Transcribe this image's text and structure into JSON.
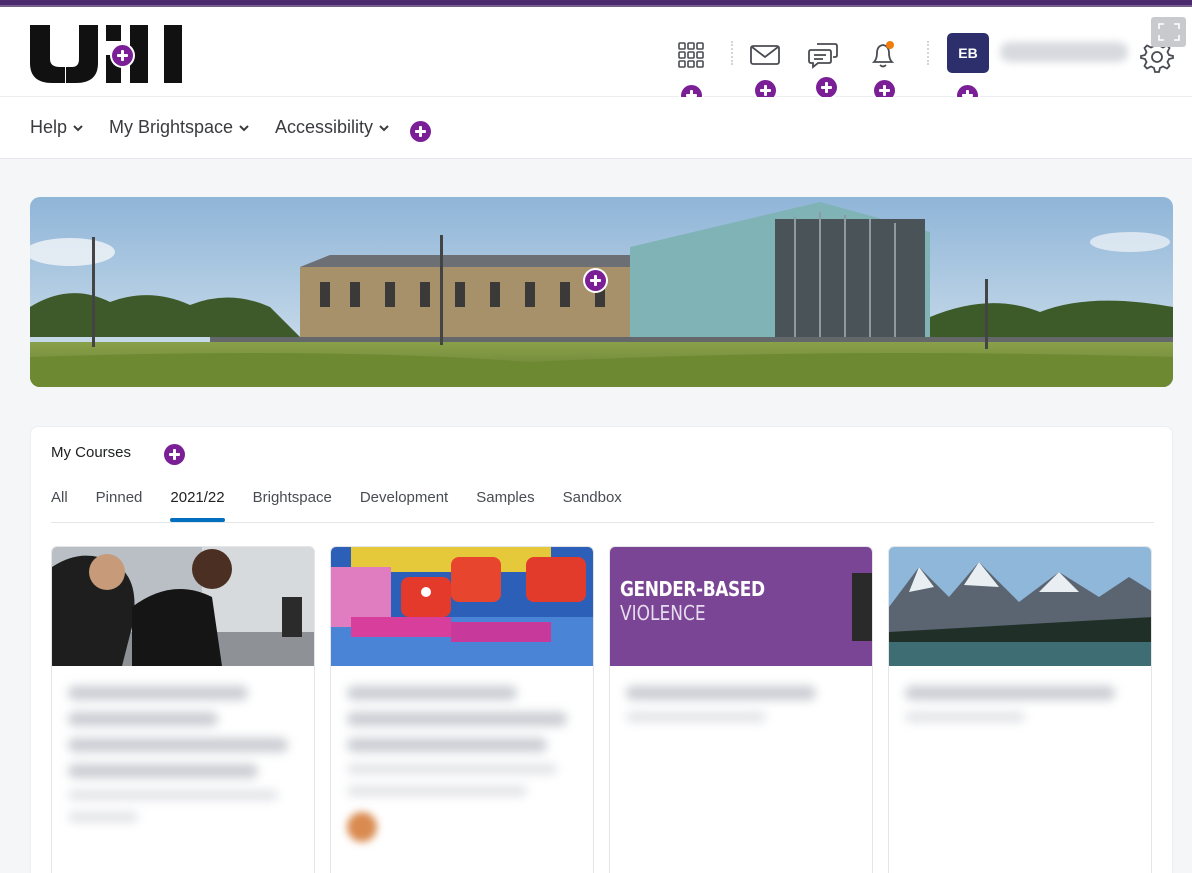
{
  "header": {
    "logo_text": "UHI",
    "avatar_initials": "EB",
    "icons": [
      "waffle-menu-icon",
      "mail-icon",
      "chat-icon",
      "bell-icon",
      "gear-icon"
    ],
    "notification_dot_color": "#f07d0c"
  },
  "nav": {
    "items": [
      {
        "label": "Help"
      },
      {
        "label": "My Brightspace"
      },
      {
        "label": "Accessibility"
      }
    ]
  },
  "courses": {
    "title": "My Courses",
    "tabs": [
      "All",
      "Pinned",
      "2021/22",
      "Brightspace",
      "Development",
      "Samples",
      "Sandbox"
    ],
    "active_tab": "2021/22",
    "cards": [
      {
        "image": "workshop-photo"
      },
      {
        "image": "craft-photo"
      },
      {
        "image": "banner",
        "banner_line1": "GENDER-BASED",
        "banner_line2": "VIOLENCE"
      },
      {
        "image": "mountain-photo"
      }
    ]
  },
  "colors": {
    "brand_purple": "#4b2a6e",
    "marker_purple": "#7a1f96",
    "avatar_bg": "#2d2f6c",
    "tab_active": "#006fbf",
    "card_banner": "#7b4595"
  }
}
